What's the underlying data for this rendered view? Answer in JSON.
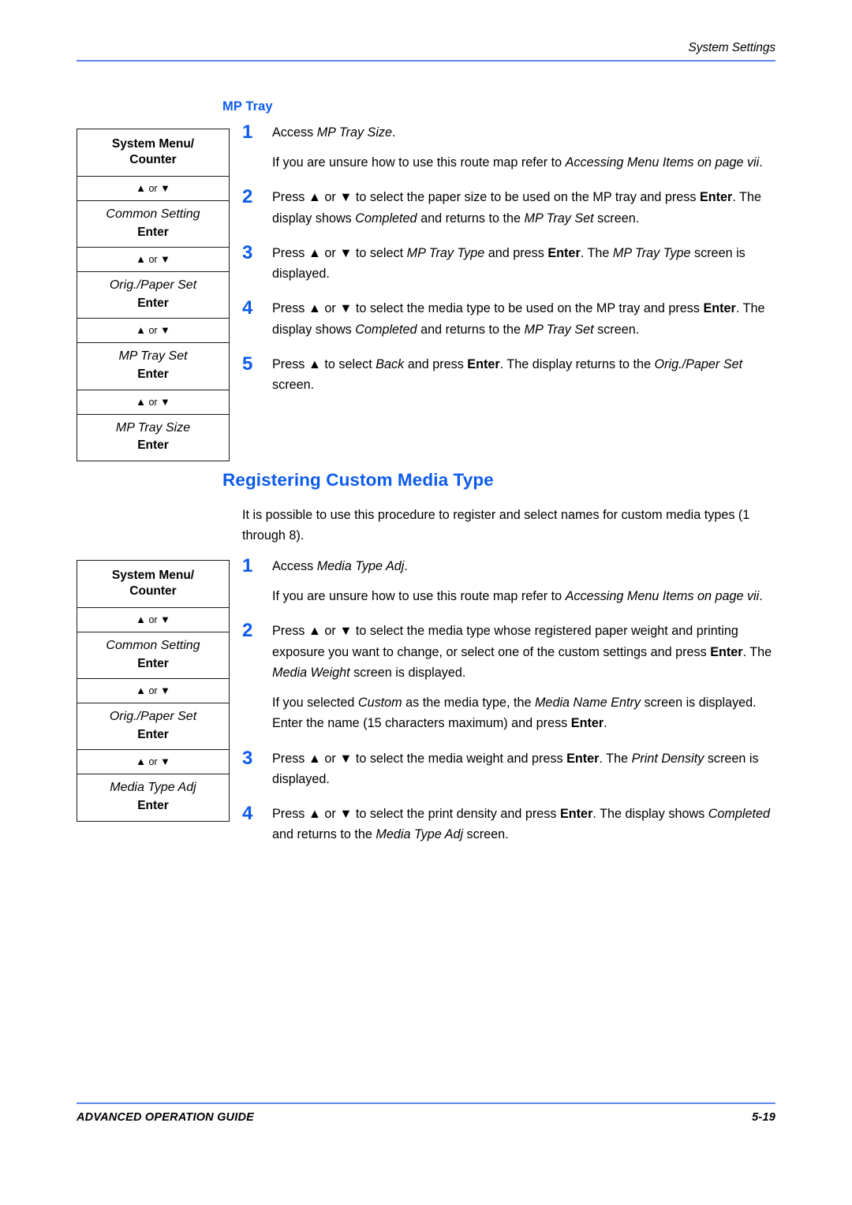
{
  "header": {
    "title": "System Settings",
    "rule_color": "#5b86ef"
  },
  "footer": {
    "guide_label": "ADVANCED OPERATION GUIDE",
    "page_number": "5-19",
    "rule_color": "#5b86ef"
  },
  "colors": {
    "heading_blue": "#0d5beb",
    "step_number_blue": "#0d5beb",
    "rule_blue": "#5b86ef",
    "text_black": "#000000"
  },
  "sections": [
    {
      "id": "mp-tray",
      "kind": "sub-heading",
      "heading": "MP Tray",
      "routemap": {
        "header": "System Menu/ Counter",
        "header_line1": "System Menu/",
        "header_line2": "Counter",
        "arrow_label": "▲ or ▼",
        "arrow_up": "▲",
        "arrow_down": "▼",
        "arrow_or": "or",
        "enter_label": "Enter",
        "items": [
          {
            "label": "Common Setting",
            "key": "Enter"
          },
          {
            "label": "Orig./Paper Set",
            "key": "Enter"
          },
          {
            "label": "MP Tray Set",
            "key": "Enter"
          },
          {
            "label": "MP Tray Size",
            "key": "Enter"
          }
        ]
      },
      "steps": [
        {
          "number": "1",
          "paragraphs": [
            "Access <i>MP Tray Size</i>.",
            "If you are unsure how to use this route map refer to <i>Accessing Menu Items on page vii</i>."
          ]
        },
        {
          "number": "2",
          "paragraphs": [
            "Press <t>▲</t> or <t>▼</t> to select the paper size to be used on the MP tray and press <b>Enter</b>. The display shows <i>Completed</i> and returns to the <i>MP Tray Set</i> screen."
          ]
        },
        {
          "number": "3",
          "paragraphs": [
            "Press <t>▲</t> or <t>▼</t> to select <i>MP Tray Type</i> and press <b>Enter</b>. The <i>MP Tray Type</i> screen is displayed."
          ]
        },
        {
          "number": "4",
          "paragraphs": [
            "Press <t>▲</t> or <t>▼</t> to select the media type to be used on the MP tray and press <b>Enter</b>. The display shows <i>Completed</i> and returns to the <i>MP Tray Set</i> screen."
          ]
        },
        {
          "number": "5",
          "paragraphs": [
            "Press <t>▲</t> to select <i>Back</i> and press <b>Enter</b>. The display returns to the <i>Orig./Paper Set</i> screen."
          ]
        }
      ]
    },
    {
      "id": "registering-custom-media-type",
      "kind": "section-heading",
      "heading": "Registering Custom Media Type",
      "intro": "It is possible to use this procedure to register and select names for custom media types (1 through 8).",
      "routemap": {
        "header": "System Menu/ Counter",
        "header_line1": "System Menu/",
        "header_line2": "Counter",
        "arrow_label": "▲ or ▼",
        "arrow_up": "▲",
        "arrow_down": "▼",
        "arrow_or": "or",
        "enter_label": "Enter",
        "items": [
          {
            "label": "Common Setting",
            "key": "Enter"
          },
          {
            "label": "Orig./Paper Set",
            "key": "Enter"
          },
          {
            "label": "Media Type Adj",
            "key": "Enter"
          }
        ]
      },
      "steps": [
        {
          "number": "1",
          "paragraphs": [
            "Access <i>Media Type Adj</i>.",
            "If you are unsure how to use this route map refer to <i>Accessing Menu Items on page vii</i>."
          ]
        },
        {
          "number": "2",
          "paragraphs": [
            "Press <t>▲</t> or <t>▼</t> to select the media type whose registered paper weight and printing exposure you want to change, or select one of the custom settings and press <b>Enter</b>. The <i>Media Weight</i> screen is displayed.",
            "If you selected <i>Custom</i> as the media type, the <i>Media Name Entry</i> screen is displayed. Enter the name (15 characters maximum) and press <b>Enter</b>."
          ]
        },
        {
          "number": "3",
          "paragraphs": [
            "Press <t>▲</t> or <t>▼</t> to select the media weight and press <b>Enter</b>. The <i>Print Density</i> screen is displayed."
          ]
        },
        {
          "number": "4",
          "paragraphs": [
            "Press <t>▲</t> or <t>▼</t> to select the print density and press <b>Enter</b>. The display shows <i>Completed</i> and returns to the <i>Media Type Adj</i> screen."
          ]
        }
      ]
    }
  ]
}
